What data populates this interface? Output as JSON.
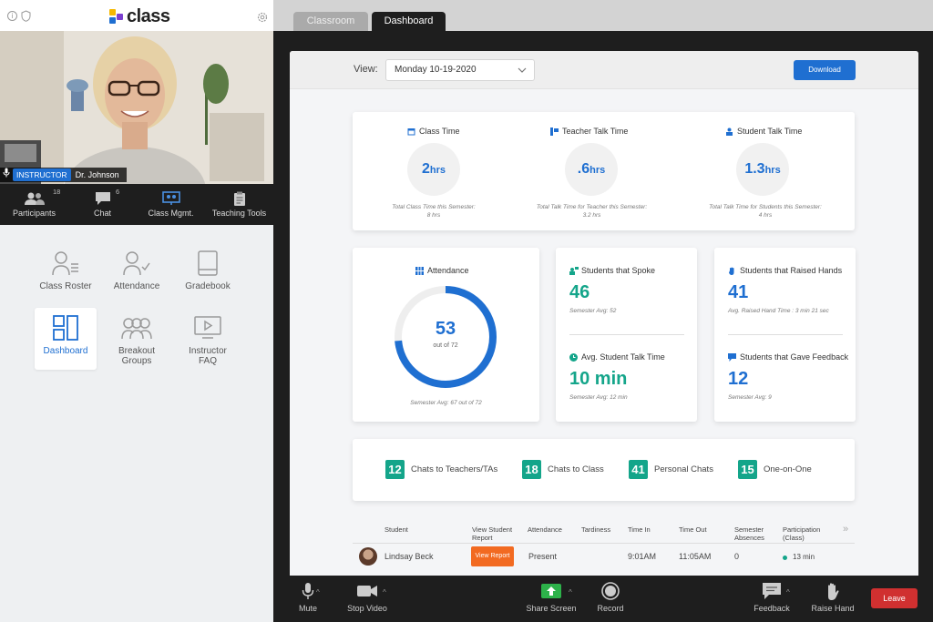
{
  "app": {
    "logo_text": "class",
    "brand_colors": [
      "#f5b800",
      "#7b3fd0",
      "#1f6fd1"
    ]
  },
  "left_top": {
    "info_icon": "info-icon",
    "shield_icon": "shield-icon",
    "settings_icon": "gear-icon"
  },
  "video": {
    "badge": "INSTRUCTOR",
    "name": "Dr. Johnson"
  },
  "toolbar": {
    "participants_label": "Participants",
    "participants_count": "18",
    "chat_label": "Chat",
    "chat_count": "6",
    "class_mgmt_label": "Class Mgmt.",
    "teaching_tools_label": "Teaching Tools"
  },
  "grid": {
    "roster": "Class Roster",
    "attendance": "Attendance",
    "gradebook": "Gradebook",
    "dashboard": "Dashboard",
    "breakout_1": "Breakout",
    "breakout_2": "Groups",
    "faq_1": "Instructor",
    "faq_2": "FAQ"
  },
  "tabs": {
    "classroom": "Classroom",
    "dashboard": "Dashboard"
  },
  "board": {
    "view_label": "View:",
    "view_value": "Monday 10-19-2020",
    "download_label": "Download"
  },
  "time_stats": {
    "class_time": {
      "title": "Class Time",
      "value": "2",
      "unit": "hrs",
      "note1": "Total Class Time this Semester:",
      "note2": "8 hrs"
    },
    "teacher_talk": {
      "title": "Teacher Talk Time",
      "value": ".6",
      "unit": "hrs",
      "note1": "Total Talk Time for Teacher this Semester:",
      "note2": "3.2 hrs"
    },
    "student_talk": {
      "title": "Student Talk Time",
      "value": "1.3",
      "unit": "hrs",
      "note1": "Total Talk Time for Students this Semester:",
      "note2": "4 hrs"
    }
  },
  "attendance": {
    "title": "Attendance",
    "value": "53",
    "of_text": "out of 72",
    "present": 53,
    "total": 72,
    "note": "Semester Avg: 67 out of 72"
  },
  "spoke": {
    "title": "Students that Spoke",
    "value": "46",
    "note": "Semester Avg: 52"
  },
  "avg_talk": {
    "title": "Avg. Student Talk Time",
    "value": "10 min",
    "note": "Semester Avg: 12 min"
  },
  "raised": {
    "title": "Students that Raised Hands",
    "value": "41",
    "note": "Avg. Raised Hand Time : 3 min 21 sec"
  },
  "feedback": {
    "title": "Students that Gave Feedback",
    "value": "12",
    "note": "Semester Avg: 9"
  },
  "chats": [
    {
      "num": "12",
      "label": "Chats to Teachers/TAs"
    },
    {
      "num": "18",
      "label": "Chats to Class"
    },
    {
      "num": "41",
      "label": "Personal Chats"
    },
    {
      "num": "15",
      "label": "One-on-One"
    }
  ],
  "table": {
    "headers": {
      "student": "Student",
      "report_1": "View Student",
      "report_2": "Report",
      "attendance": "Attendance",
      "tardiness": "Tardiness",
      "time_in": "Time In",
      "time_out": "Time Out",
      "absences_1": "Semester",
      "absences_2": "Absences",
      "participation_1": "Participation",
      "participation_2": "(Class)",
      "more": "»"
    },
    "row": {
      "name": "Lindsay Beck",
      "report_btn": "View Report",
      "attendance": "Present",
      "time_in": "9:01AM",
      "time_out": "11:05AM",
      "absences": "0",
      "participation": "13 min"
    }
  },
  "bottom": {
    "mute": "Mute",
    "stop_video": "Stop Video",
    "share_screen": "Share Screen",
    "record": "Record",
    "feedback": "Feedback",
    "raise_hand": "Raise Hand",
    "leave": "Leave"
  },
  "colors": {
    "accent": "#1f6fd1",
    "teal": "#14a58a",
    "orange": "#f26a21",
    "leave": "#d03030"
  }
}
